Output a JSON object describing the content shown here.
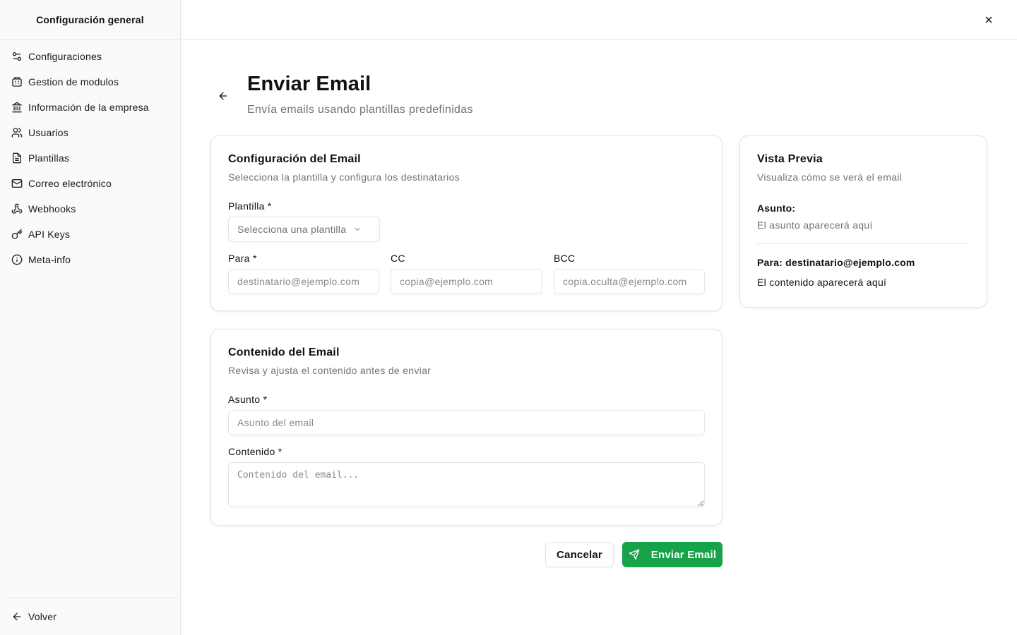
{
  "colors": {
    "accent": "#16a34a",
    "muted_text": "#737373",
    "border": "#e5e5e5"
  },
  "sidebar": {
    "title": "Configuración general",
    "items": [
      {
        "label": "Configuraciones",
        "icon": "settings-sliders-icon"
      },
      {
        "label": "Gestion de modulos",
        "icon": "modules-icon"
      },
      {
        "label": "Información de la empresa",
        "icon": "landmark-icon"
      },
      {
        "label": "Usuarios",
        "icon": "users-icon"
      },
      {
        "label": "Plantillas",
        "icon": "file-text-icon"
      },
      {
        "label": "Correo electrónico",
        "icon": "mail-icon"
      },
      {
        "label": "Webhooks",
        "icon": "webhook-icon"
      },
      {
        "label": "API Keys",
        "icon": "key-icon"
      },
      {
        "label": "Meta-info",
        "icon": "info-icon"
      }
    ],
    "back_label": "Volver"
  },
  "page": {
    "title": "Enviar Email",
    "subtitle": "Envía emails usando plantillas predefinidas"
  },
  "config_card": {
    "title": "Configuración del Email",
    "description": "Selecciona la plantilla y configura los destinatarios",
    "template_label": "Plantilla *",
    "template_placeholder": "Selecciona una plantilla",
    "to_label": "Para *",
    "to_placeholder": "destinatario@ejemplo.com",
    "cc_label": "CC",
    "cc_placeholder": "copia@ejemplo.com",
    "bcc_label": "BCC",
    "bcc_placeholder": "copia.oculta@ejemplo.com"
  },
  "content_card": {
    "title": "Contenido del Email",
    "description": "Revisa y ajusta el contenido antes de enviar",
    "subject_label": "Asunto *",
    "subject_placeholder": "Asunto del email",
    "content_label": "Contenido *",
    "content_placeholder": "Contenido del email..."
  },
  "preview_card": {
    "title": "Vista Previa",
    "description": "Visualiza cómo se verá el email",
    "subject_label": "Asunto:",
    "subject_placeholder": "El asunto aparecerá aquí",
    "to_line": "Para: destinatario@ejemplo.com",
    "content_placeholder": "El contenido aparecerá aquí"
  },
  "actions": {
    "cancel_label": "Cancelar",
    "send_label": "Enviar Email"
  }
}
